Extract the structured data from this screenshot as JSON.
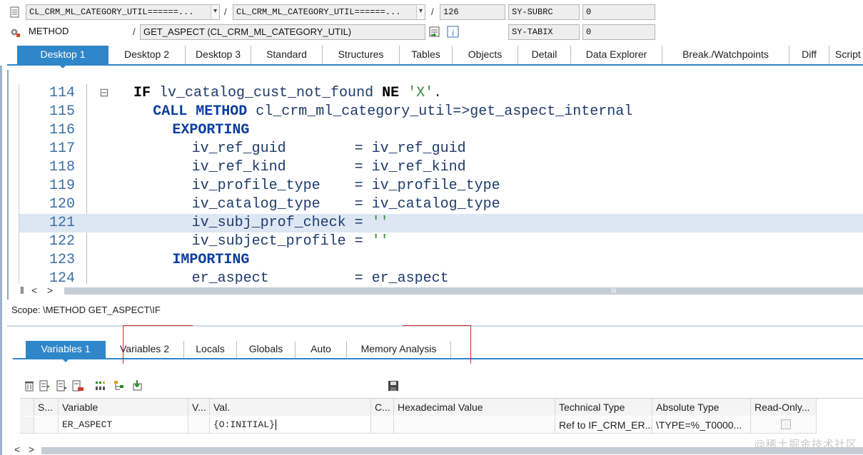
{
  "info": {
    "program": "CL_CRM_ML_CATEGORY_UTIL======...",
    "include": "CL_CRM_ML_CATEGORY_UTIL======...",
    "line": "126",
    "method_kind": "METHOD",
    "method": "GET_ASPECT (CL_CRM_ML_CATEGORY_UTIL)",
    "sy_subrc_label": "SY-SUBRC",
    "sy_subrc_value": "0",
    "sy_tabix_label": "SY-TABIX",
    "sy_tabix_value": "0",
    "sep": "/"
  },
  "tabs": [
    "Desktop 1",
    "Desktop 2",
    "Desktop 3",
    "Standard",
    "Structures",
    "Tables",
    "Objects",
    "Detail",
    "Data Explorer",
    "Break./Watchpoints",
    "Diff",
    "Script"
  ],
  "code": [
    {
      "ln": "114",
      "parts": [
        [
          "kw-b",
          "IF"
        ],
        [
          "",
          " lv_catalog_cust_not_found "
        ],
        [
          "kw-b",
          "NE"
        ],
        [
          "",
          " "
        ],
        [
          "str",
          "'X'"
        ],
        [
          "",
          "."
        ]
      ],
      "indent": 0,
      "fold": "⊟"
    },
    {
      "ln": "115",
      "parts": [
        [
          "kw",
          "CALL METHOD"
        ],
        [
          "",
          " cl_crm_ml_category_util=>get_aspect_internal"
        ]
      ],
      "indent": 2
    },
    {
      "ln": "116",
      "parts": [
        [
          "kw",
          "EXPORTING"
        ]
      ],
      "indent": 4
    },
    {
      "ln": "117",
      "parts": [
        [
          "",
          "iv_ref_guid        = iv_ref_guid"
        ]
      ],
      "indent": 6
    },
    {
      "ln": "118",
      "parts": [
        [
          "",
          "iv_ref_kind        = iv_ref_kind"
        ]
      ],
      "indent": 6
    },
    {
      "ln": "119",
      "parts": [
        [
          "",
          "iv_profile_type    = iv_profile_type"
        ]
      ],
      "indent": 6
    },
    {
      "ln": "120",
      "parts": [
        [
          "",
          "iv_catalog_type    = iv_catalog_type"
        ]
      ],
      "indent": 6
    },
    {
      "ln": "121",
      "parts": [
        [
          "",
          "iv_subj_prof_check = "
        ],
        [
          "str",
          "''"
        ]
      ],
      "indent": 6,
      "highlight": true
    },
    {
      "ln": "122",
      "parts": [
        [
          "",
          "iv_subject_profile = "
        ],
        [
          "str",
          "''"
        ]
      ],
      "indent": 6
    },
    {
      "ln": "123",
      "parts": [
        [
          "kw",
          "IMPORTING"
        ]
      ],
      "indent": 4
    },
    {
      "ln": "124",
      "parts": [
        [
          "",
          "er_aspect          = er_aspect"
        ]
      ],
      "indent": 6
    }
  ],
  "scope": "Scope: \\METHOD GET_ASPECT\\IF",
  "var_tabs": [
    "Variables 1",
    "Variables 2",
    "Locals",
    "Globals",
    "Auto",
    "Memory Analysis"
  ],
  "var_table": {
    "headers": [
      "S...",
      "Variable",
      "V...",
      "Val.",
      "C...",
      "Hexadecimal Value",
      "Technical Type",
      "Absolute Type",
      "Read-Only..."
    ],
    "row": {
      "variable": "ER_ASPECT",
      "value": "{O:INITIAL}",
      "technical_type": "Ref to IF_CRM_ER...",
      "absolute_type": "\\TYPE=%_T0000..."
    }
  },
  "watermark": "@稀土掘金技术社区",
  "colors": {
    "accent": "#2f86c9",
    "highlight_line": "#dde6f3",
    "red_box": "#cc2a2a"
  }
}
